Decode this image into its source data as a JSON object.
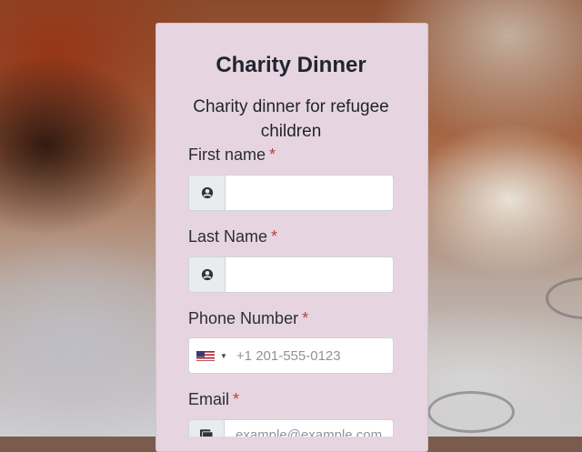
{
  "form": {
    "title": "Charity Dinner",
    "subtitle": "Charity dinner for refugee children",
    "required_marker": "*",
    "fields": [
      {
        "label": "First name",
        "icon": "user-circle-icon",
        "value": "",
        "placeholder": ""
      },
      {
        "label": "Last Name",
        "icon": "user-circle-icon",
        "value": "",
        "placeholder": ""
      },
      {
        "label": "Phone Number",
        "icon": "us-flag-icon",
        "value": "",
        "placeholder": "+1 201-555-0123"
      },
      {
        "label": "Email",
        "icon": "address-card-icon",
        "value": "",
        "placeholder": "example@example.com"
      }
    ]
  },
  "colors": {
    "card_background": "#e6d5e0",
    "required_marker": "#b3424a",
    "title_text": "#1f2430"
  }
}
